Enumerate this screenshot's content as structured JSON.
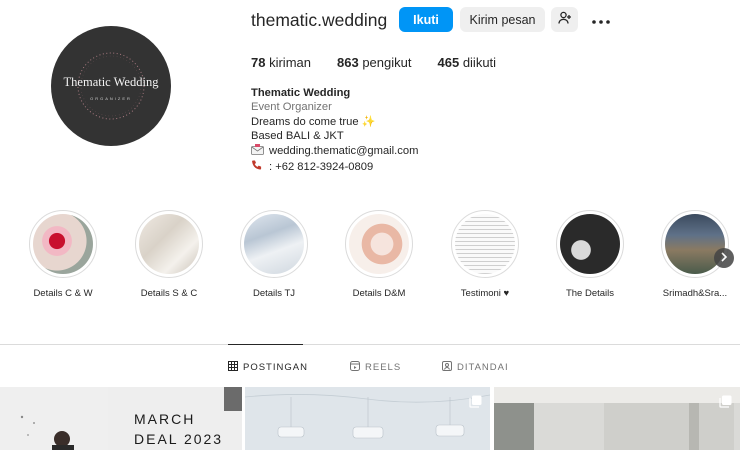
{
  "profile": {
    "username": "thematic.wedding",
    "avatar_text": "Thematic Wedding",
    "avatar_subtext": "ORGANIZER",
    "actions": {
      "follow": "Ikuti",
      "message": "Kirim pesan",
      "suggest_icon": "add-person-icon",
      "more_icon": "more-dots-icon"
    },
    "stats": [
      {
        "value": "78",
        "label": "kiriman"
      },
      {
        "value": "863",
        "label": "pengikut"
      },
      {
        "value": "465",
        "label": "diikuti"
      }
    ],
    "bio": {
      "name": "Thematic Wedding",
      "category": "Event Organizer",
      "line1": "Dreams do come true",
      "line1_emoji": "✨",
      "line2": "Based BALI & JKT",
      "email": "wedding.thematic@gmail.com",
      "phone": ": +62 812-3924-0809"
    }
  },
  "highlights": [
    {
      "label": "Details C & W"
    },
    {
      "label": "Details S & C"
    },
    {
      "label": "Details TJ"
    },
    {
      "label": "Details D&M"
    },
    {
      "label": "Testimoni ♥"
    },
    {
      "label": "The Details"
    },
    {
      "label": "Srimadh&Sra..."
    }
  ],
  "tabs": [
    {
      "label": "POSTINGAN",
      "icon": "grid-icon",
      "active": true
    },
    {
      "label": "REELS",
      "icon": "reels-icon",
      "active": false
    },
    {
      "label": "DITANDAI",
      "icon": "tagged-icon",
      "active": false
    }
  ],
  "posts": [
    {
      "text_line1": "MARCH",
      "text_line2": "DEAL 2023"
    },
    {
      "multi": true
    },
    {
      "multi": true
    }
  ],
  "colors": {
    "primary": "#0095f6",
    "secondary_bg": "#efefef",
    "text": "#262626",
    "muted": "#737373"
  }
}
